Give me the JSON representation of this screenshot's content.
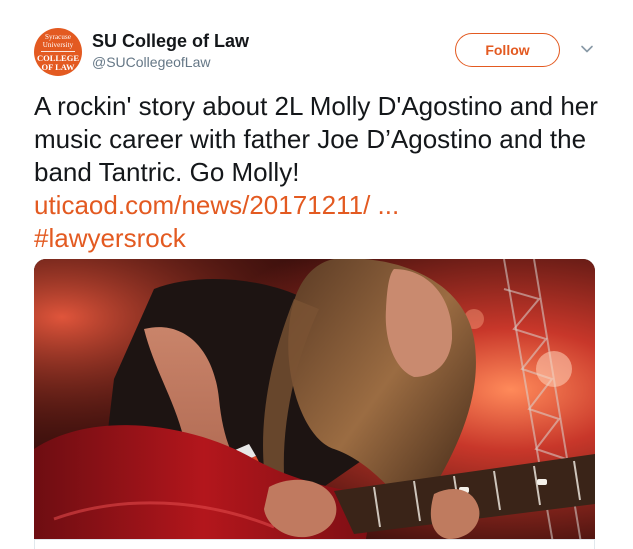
{
  "account": {
    "avatar_line1": "Syracuse University",
    "avatar_line2": "COLLEGE\nOF LAW",
    "display_name": "SU College of Law",
    "handle": "@SUCollegeofLaw"
  },
  "actions": {
    "follow_label": "Follow"
  },
  "tweet": {
    "text": "A rockin' story about 2L Molly D'Agostino and her music career with father Joe D’Agostino and the band Tantric. Go Molly!",
    "link": "uticaod.com/news/20171211/ ...",
    "hashtag": "#lawyersrock"
  },
  "colors": {
    "accent": "#e35a21",
    "text": "#14171a",
    "muted": "#657786"
  },
  "icons": {
    "caret": "chevron-down-icon"
  }
}
